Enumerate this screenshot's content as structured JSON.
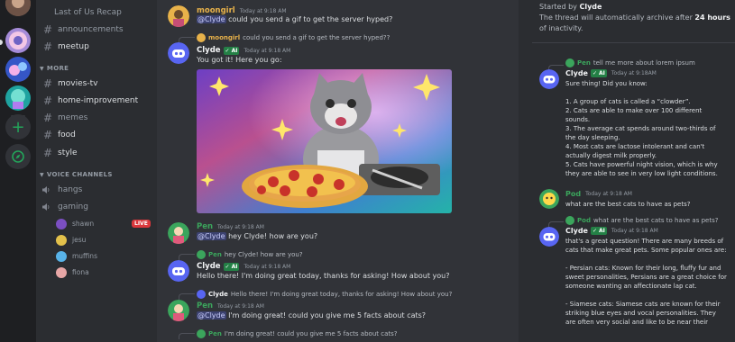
{
  "channels": {
    "recap": "Last of Us Recap",
    "text_top": [
      {
        "name": "announcements"
      },
      {
        "name": "meetup"
      }
    ],
    "more_category": "MORE",
    "more": [
      {
        "name": "movies-tv"
      },
      {
        "name": "home-improvement"
      },
      {
        "name": "memes"
      },
      {
        "name": "food"
      },
      {
        "name": "style"
      }
    ],
    "voice_category": "VOICE CHANNELS",
    "voice": [
      {
        "name": "hangs"
      },
      {
        "name": "gaming"
      }
    ],
    "voice_users": [
      {
        "name": "shawn"
      },
      {
        "name": "jesu"
      },
      {
        "name": "muffins"
      },
      {
        "name": "fiona"
      }
    ],
    "live_badge": "LIVE"
  },
  "chat": {
    "ai_badge": "AI",
    "messages": [
      {
        "author": "moongirl",
        "time": "Today at 9:18 AM",
        "mention": "@Clyde",
        "text": " could you send a gif to get the server hyped?"
      },
      {
        "reply_author": "moongirl",
        "reply_text": "could you send a gif to get the server hyped??",
        "author": "Clyde",
        "time": "Today at 9:18 AM",
        "text": "You got it! Here you go:"
      },
      {
        "author": "Pen",
        "time": "Today at 9:18 AM",
        "mention": "@Clyde",
        "text": " hey Clyde! how are you?"
      },
      {
        "reply_author": "Pen",
        "reply_text": "hey Clyde! how are you?",
        "author": "Clyde",
        "time": "Today at 9:18 AM",
        "text": "Hello there! I'm doing great today, thanks for asking! How about you?"
      },
      {
        "reply_author": "Clyde",
        "reply_text": "Hello there! I'm doing great today, thanks for asking! How about you?",
        "author": "Pen",
        "time": "Today at 9:18 AM",
        "mention": "@Clyde",
        "text": " I'm doing great! could you give me 5 facts about cats?"
      },
      {
        "reply_author": "Pen",
        "reply_text": "I'm doing great! could you give me 5 facts about cats?"
      }
    ]
  },
  "thread": {
    "started_by_label": "Started by ",
    "started_by_user": "Clyde",
    "archive_pre": "The thread will automatically archive after ",
    "archive_bold": "24 hours",
    "archive_post": " of inactivity.",
    "msg1": {
      "reply_author": "Pen",
      "reply_text": "tell me more about lorem ipsum",
      "author": "Clyde",
      "time": "Today at 9:18AM",
      "lines": [
        "Sure thing! Did you know:",
        "",
        "1. A group of cats is called a “clowder”.",
        "2. Cats are able to make over 100 different sounds.",
        " 3. The average cat spends around two-thirds of the day sleeping.",
        "4. Most cats are lactose intolerant and can't actually digest milk properly.",
        "5. Cats have powerful night vision, which is why they are able to see in very low light conditions."
      ]
    },
    "msg2": {
      "author": "Pod",
      "time": "Today at 9:18 AM",
      "text": "what are the best cats to have as pets?"
    },
    "msg3": {
      "reply_author": "Pod",
      "reply_text": "what are the best cats to have as pets?",
      "author": "Clyde",
      "time": "Today at 9:18 AM",
      "lines": [
        "that's a great question! There are many breeds of cats that make great pets. Some popular ones are:",
        "",
        "- Persian cats: Known for their long, fluffy fur and sweet personalities, Persians are a great choice for someone wanting an affectionate lap cat.",
        "",
        "- Siamese cats: Siamese cats are known for their striking blue eyes and vocal personalities. They are often very social and like to be near their"
      ]
    }
  },
  "colors": {
    "moongirl": "#e8b24a",
    "pen": "#3ba55c",
    "pod": "#3ba55c",
    "clyde": "#f2f3f5",
    "ai_badge": "#248046"
  }
}
